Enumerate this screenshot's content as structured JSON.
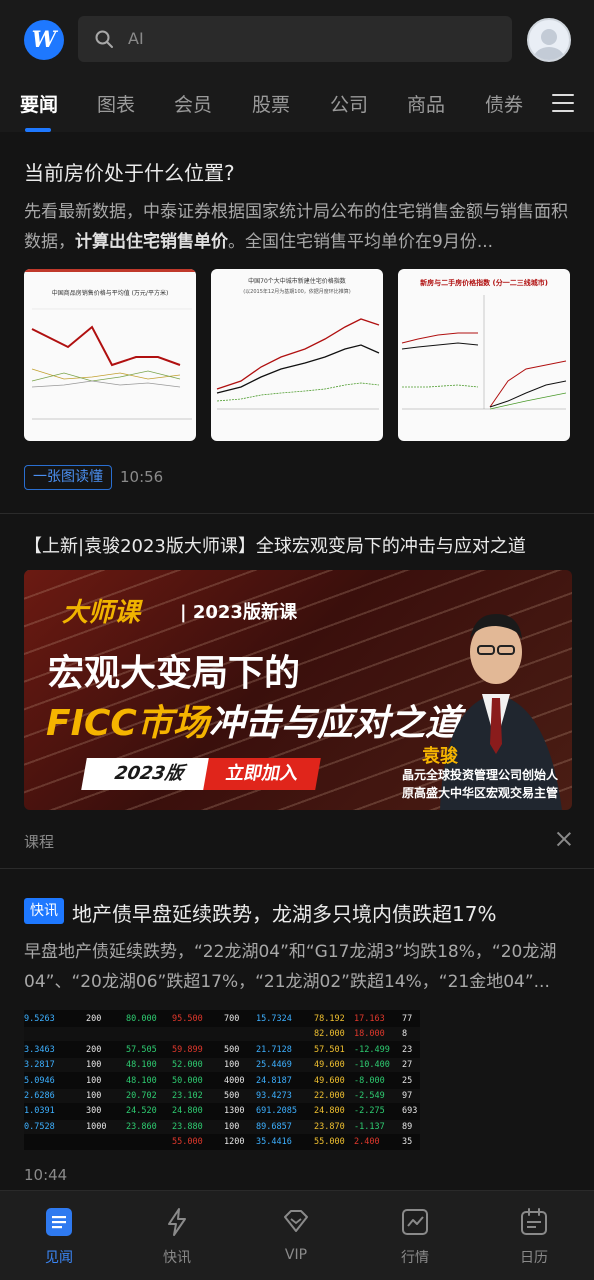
{
  "header": {
    "logo_text": "W",
    "search_placeholder": "AI"
  },
  "tabs": [
    {
      "label": "要闻",
      "active": true
    },
    {
      "label": "图表"
    },
    {
      "label": "会员"
    },
    {
      "label": "股票"
    },
    {
      "label": "公司"
    },
    {
      "label": "商品"
    },
    {
      "label": "债券"
    }
  ],
  "article1": {
    "title": "当前房价处于什么位置?",
    "summary_pre": "先看最新数据，中泰证券根据国家统计局公布的住宅销售金额与销售面积数据，",
    "summary_bold": "计算出住宅销售单价",
    "summary_post": "。全国住宅销售平均单价在9月份...",
    "tag": "一张图读懂",
    "time": "10:56",
    "thumb1_title": "中国商品房销售价格与平均值 (万元/平方米)",
    "thumb2_title": "中国70个大中城市新建住宅价格指数",
    "thumb2_sub": "(以2015年12月为基期100，依据月度环比推算)",
    "thumb3_title": "新房与二手房价格指数 (分一二三线城市)"
  },
  "ad": {
    "title": "【上新|袁骏2023版大师课】全球宏观变局下的冲击与应对之道",
    "series": "大师课",
    "series_tag": "| 2023版新课",
    "line1": "宏观大变局下的",
    "line2_gold": "FICC市场",
    "line2_white": "冲击与应对之道",
    "year_btn": "2023版",
    "join_btn": "立即加入",
    "name": "袁骏",
    "caption1": "晶元全球投资管理公司创始人",
    "caption2": "原高盛大中华区宏观交易主管",
    "label": "课程"
  },
  "flash": {
    "tag": "快讯",
    "title": "地产债早盘延续跌势，龙湖多只境内债跌超17%",
    "summary": "早盘地产债延续跌势，“22龙湖04”和“G17龙湖3”均跌18%，“20龙湖04”、“20龙湖06”跌超17%，“21龙湖02”跌超14%，“21金地04”...",
    "time": "10:44",
    "table_rows": [
      [
        "9.5263",
        "200",
        "80.000",
        "95.500",
        "700",
        "15.7324",
        "78.192",
        "17.163",
        "77"
      ],
      [
        "",
        "",
        "",
        "",
        "",
        "",
        "82.000",
        "18.000",
        "8"
      ],
      [
        "3.3463",
        "200",
        "57.505",
        "59.899",
        "500",
        "21.7128",
        "57.501",
        "-12.499",
        "23"
      ],
      [
        "3.2817",
        "100",
        "48.100",
        "52.000",
        "100",
        "25.4469",
        "49.600",
        "-10.400",
        "27"
      ],
      [
        "5.0946",
        "100",
        "48.100",
        "50.000",
        "4000",
        "24.8187",
        "49.600",
        "-8.000",
        "25"
      ],
      [
        "2.6286",
        "100",
        "20.702",
        "23.102",
        "500",
        "93.4273",
        "22.000",
        "-2.549",
        "97"
      ],
      [
        "1.0391",
        "300",
        "24.520",
        "24.800",
        "1300",
        "691.2085",
        "24.800",
        "-2.275",
        "693"
      ],
      [
        "0.7528",
        "1000",
        "23.860",
        "23.880",
        "100",
        "89.6857",
        "23.870",
        "-1.137",
        "89"
      ],
      [
        "",
        "",
        "",
        "55.000",
        "1200",
        "35.4416",
        "55.000",
        "2.400",
        "35"
      ]
    ]
  },
  "nav": [
    {
      "label": "见闻",
      "icon": "news-icon",
      "active": true
    },
    {
      "label": "快讯",
      "icon": "lightning-icon"
    },
    {
      "label": "VIP",
      "icon": "diamond-icon"
    },
    {
      "label": "行情",
      "icon": "chart-icon"
    },
    {
      "label": "日历",
      "icon": "calendar-icon"
    }
  ],
  "colors": {
    "accent": "#1e78ff",
    "bg": "#141414",
    "up": "#e0382c",
    "down": "#1fbf5f"
  }
}
